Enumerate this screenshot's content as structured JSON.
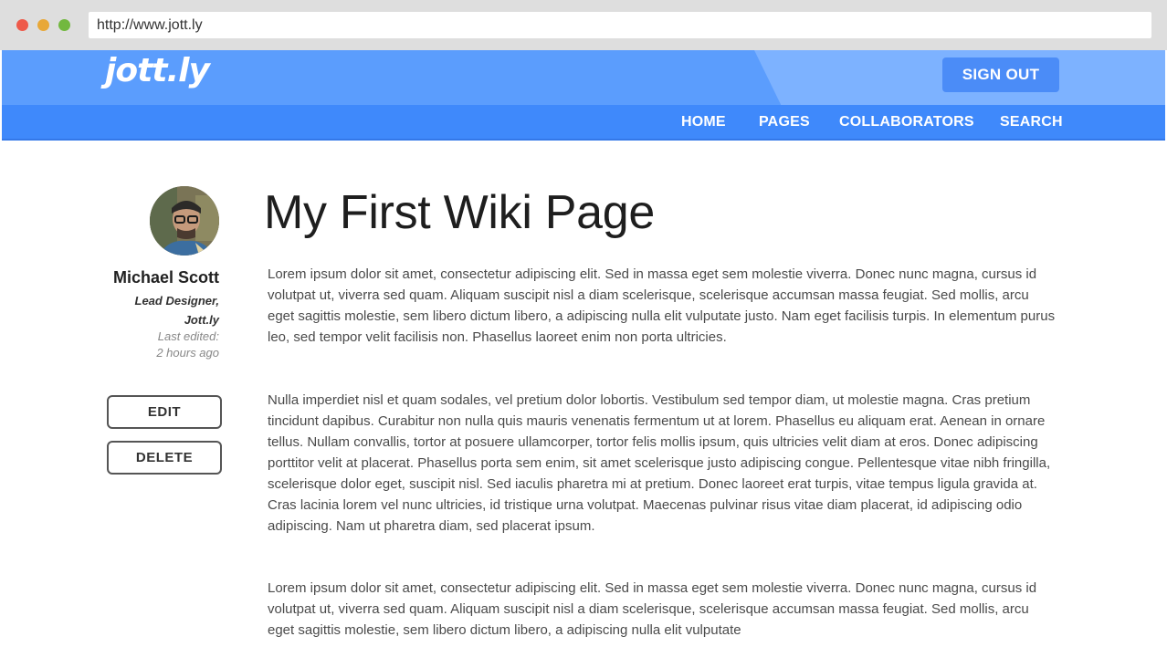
{
  "browser": {
    "url": "http://www.jott.ly"
  },
  "header": {
    "logo": "jott.ly",
    "sign_out_label": "SIGN OUT",
    "nav": [
      {
        "label": "HOME"
      },
      {
        "label": "PAGES"
      },
      {
        "label": "COLLABORATORS"
      },
      {
        "label": "SEARCH"
      }
    ]
  },
  "author": {
    "name": "Michael Scott",
    "role_line1": "Lead Designer,",
    "role_line2": "Jott.ly",
    "edited_line1": "Last edited:",
    "edited_line2": "2 hours ago"
  },
  "actions": {
    "edit_label": "EDIT",
    "delete_label": "DELETE"
  },
  "page": {
    "title": "My First Wiki Page",
    "paragraphs": [
      "Lorem ipsum dolor sit amet, consectetur adipiscing elit. Sed in massa eget sem molestie viverra. Donec nunc magna, cursus id volutpat ut, viverra sed quam. Aliquam suscipit nisl a diam scelerisque, scelerisque accumsan massa feugiat. Sed mollis, arcu eget sagittis molestie, sem libero dictum libero, a adipiscing nulla elit vulputate justo. Nam eget facilisis turpis. In elementum purus leo, sed tempor velit facilisis non. Phasellus laoreet enim non porta ultricies.",
      "Nulla imperdiet nisl et quam sodales, vel pretium dolor lobortis. Vestibulum sed tempor diam, ut molestie magna. Cras pretium tincidunt dapibus. Curabitur non nulla quis mauris venenatis fermentum ut at lorem. Phasellus eu aliquam erat. Aenean in ornare tellus. Nullam convallis, tortor at posuere ullamcorper, tortor felis mollis ipsum, quis ultricies velit diam at eros. Donec adipiscing porttitor velit at placerat. Phasellus porta sem enim, sit amet scelerisque justo adipiscing congue. Pellentesque vitae nibh fringilla, scelerisque dolor eget, suscipit nisl. Sed iaculis pharetra mi at pretium. Donec laoreet erat turpis, vitae tempus ligula gravida at. Cras lacinia lorem vel nunc ultricies, id tristique urna volutpat. Maecenas pulvinar risus vitae diam placerat, id adipiscing odio adipiscing. Nam ut pharetra diam, sed placerat ipsum.",
      "Lorem ipsum dolor sit amet, consectetur adipiscing elit. Sed in massa eget sem molestie viverra. Donec nunc magna, cursus id volutpat ut, viverra sed quam. Aliquam suscipit nisl a diam scelerisque, scelerisque accumsan massa feugiat. Sed mollis, arcu eget sagittis molestie, sem libero dictum libero, a adipiscing nulla elit vulputate"
    ]
  },
  "colors": {
    "header_blue": "#5b9dfd",
    "nav_blue": "#3f89fb",
    "button_blue": "#4b8cf7"
  }
}
